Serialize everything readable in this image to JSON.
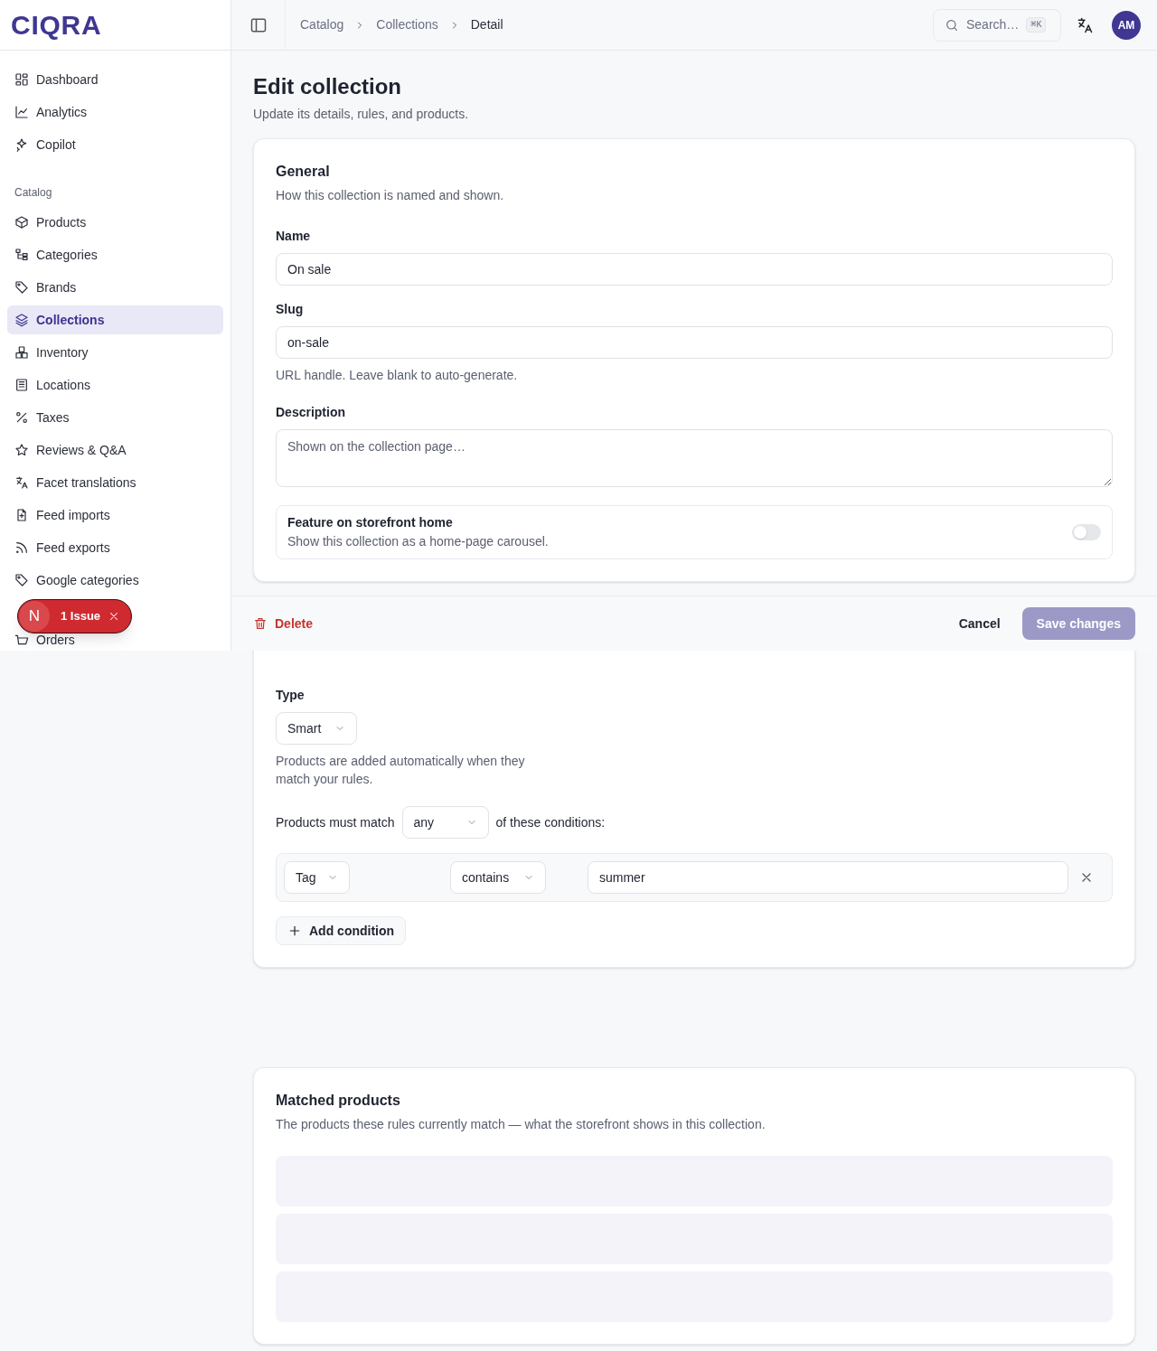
{
  "brand": "CIQRA",
  "sidebar": {
    "items": [
      {
        "label": "Dashboard",
        "selected": false
      },
      {
        "label": "Analytics",
        "selected": false
      },
      {
        "label": "Copilot",
        "selected": false
      }
    ],
    "sections": [
      {
        "title": "Catalog",
        "items": [
          {
            "label": "Products",
            "selected": false
          },
          {
            "label": "Categories",
            "selected": false
          },
          {
            "label": "Brands",
            "selected": false
          },
          {
            "label": "Collections",
            "selected": true
          },
          {
            "label": "Inventory",
            "selected": false
          },
          {
            "label": "Locations",
            "selected": false
          },
          {
            "label": "Taxes",
            "selected": false
          },
          {
            "label": "Reviews & Q&A",
            "selected": false
          },
          {
            "label": "Facet translations",
            "selected": false
          },
          {
            "label": "Feed imports",
            "selected": false
          },
          {
            "label": "Feed exports",
            "selected": false
          },
          {
            "label": "Google categories",
            "selected": false
          }
        ]
      },
      {
        "items": [
          {
            "label": "Orders",
            "selected": false
          }
        ]
      }
    ]
  },
  "breadcrumbs": [
    "Catalog",
    "Collections",
    "Detail"
  ],
  "search": {
    "placeholder": "Search…",
    "shortcut": "⌘K"
  },
  "avatar": "AM",
  "page": {
    "title": "Edit collection",
    "subtitle": "Update its details, rules, and products."
  },
  "general": {
    "title": "General",
    "subtitle": "How this collection is named and shown.",
    "fields": [
      {
        "label": "Name",
        "value": "On sale"
      },
      {
        "label": "Slug",
        "value": "on-sale",
        "help": "URL handle. Leave blank to auto-generate."
      }
    ],
    "description": {
      "label": "Description",
      "placeholder": "Shown on the collection page…"
    },
    "feature": {
      "title": "Feature on storefront home",
      "subtitle": "Show this collection as a home-page carousel.",
      "on": false
    }
  },
  "rules": {
    "type_label": "Type",
    "type": "Smart",
    "type_help": "Products are added automatically when they match your rules.",
    "match_prefix": "Products must match",
    "match": "any",
    "match_suffix": "of these conditions:",
    "conditions": [
      {
        "field": "Tag",
        "operator": "contains",
        "value": "summer"
      }
    ],
    "add_button": "Add condition"
  },
  "matched": {
    "title": "Matched products",
    "subtitle": "The products these rules currently match — what the storefront shows in this collection."
  },
  "action_bar": {
    "delete": "Delete",
    "cancel": "Cancel",
    "save": "Save changes",
    "save_disabled": true
  },
  "issue_badge": {
    "letter": "N",
    "label": "1 Issue"
  }
}
